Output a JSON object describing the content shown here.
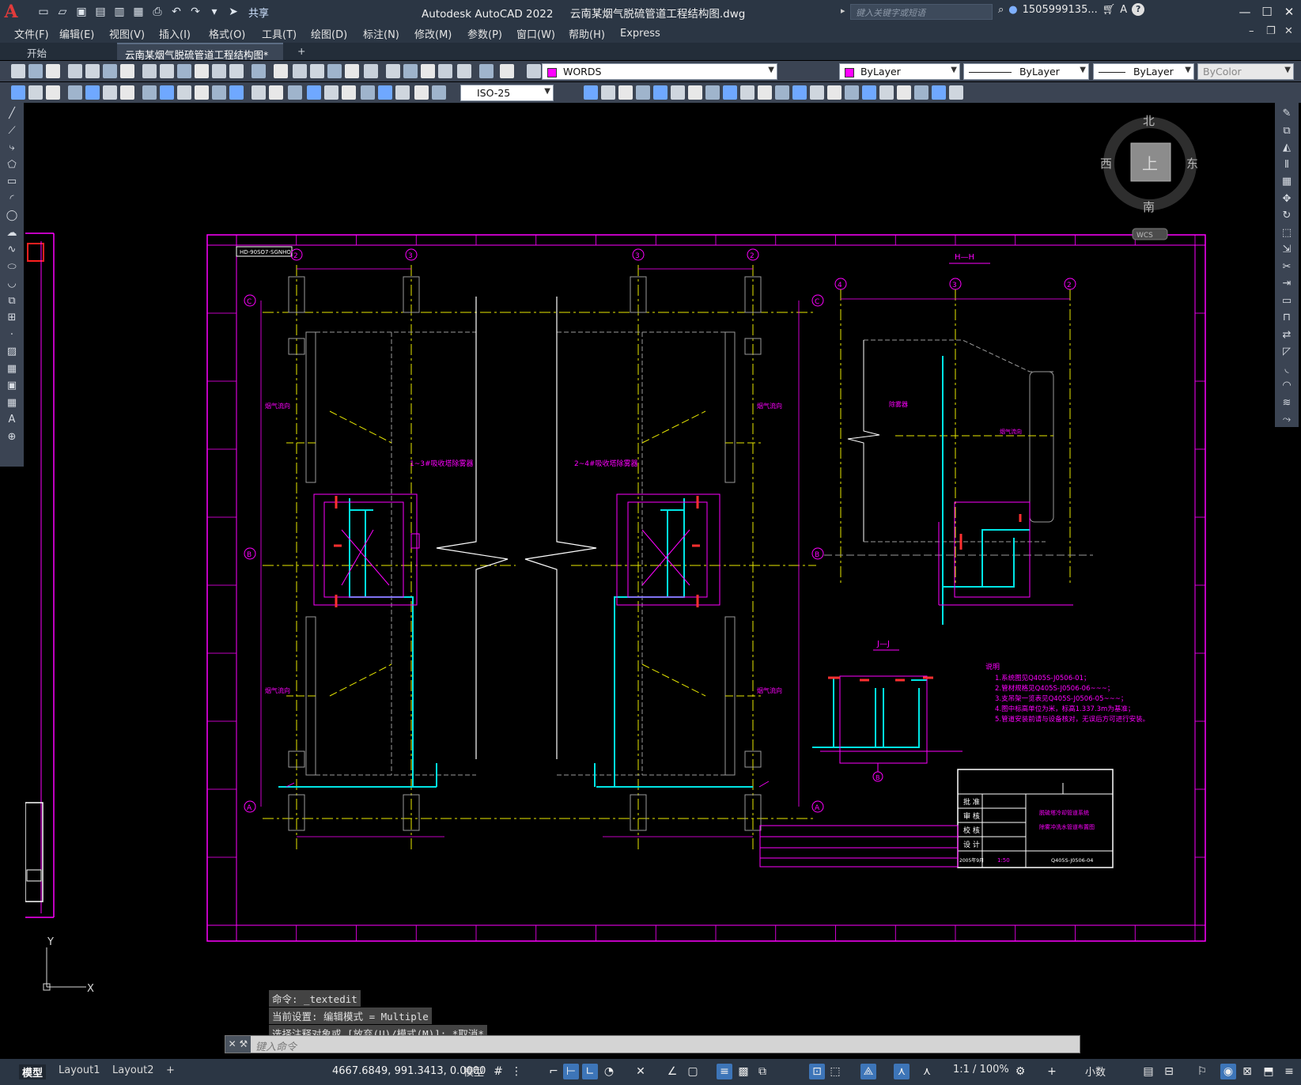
{
  "app": {
    "logo": "A",
    "title": "Autodesk AutoCAD 2022",
    "filename": "云南某烟气脱硫管道工程结构图.dwg",
    "share_label": "共享",
    "search_placeholder": "键入关键字或短语",
    "user": "1505999135...",
    "help": "?"
  },
  "menu": [
    "文件(F)",
    "编辑(E)",
    "视图(V)",
    "插入(I)",
    "格式(O)",
    "工具(T)",
    "绘图(D)",
    "标注(N)",
    "修改(M)",
    "参数(P)",
    "窗口(W)",
    "帮助(H)",
    "Express"
  ],
  "tabs": {
    "start": "开始",
    "active": "云南某烟气脱硫管道工程结构图*",
    "close": "×",
    "add": "+"
  },
  "toolbar": {
    "layer": "WORDS",
    "color": "ByLayer",
    "linetype": "ByLayer",
    "lineweight": "ByLayer",
    "plotstyle": "ByColor",
    "dimstyle": "ISO-25"
  },
  "viewcube": {
    "north": "北",
    "south": "南",
    "east": "东",
    "west": "西",
    "top": "上",
    "wcs": "WCS"
  },
  "drawing": {
    "ref_code": "HD-90SO7-SGNHO",
    "section_h": "H—H",
    "section_j": "J—J",
    "label_left_center": "1~3#吸收塔除雾器",
    "label_mid_center": "2~4#吸收塔除雾器",
    "flue_flow": "烟气流向",
    "demister": "除雾器",
    "notes_title": "说明",
    "notes": [
      "1.系统图见Q405S-J0506-01；",
      "2.管材规格见Q405S-J0506-06~~~；",
      "3.支吊架一览表见Q405S-J0506-05~~~；",
      "4.图中标高单位为米，标高1.337.3m为基准；",
      "5.管道安装前请与设备核对，无误后方可进行安装。"
    ],
    "title_block": {
      "rows": [
        "批 准",
        "审 核",
        "校 核",
        "设 计"
      ],
      "project": "脱硫塔冷却管道系统",
      "drawing_name": "除雾冲洗水管道布置图",
      "scale": "1:50",
      "drawing_no": "Q405S-J0506-04",
      "date": "2005年9月"
    }
  },
  "command": {
    "history": [
      "命令: _textedit",
      "当前设置: 编辑模式 = Multiple",
      "选择注释对象或 [放弃(U)/模式(M)]: *取消*"
    ],
    "placeholder": "键入命令"
  },
  "status": {
    "model_tab": "模型",
    "layout1": "Layout1",
    "layout2": "Layout2",
    "add": "+",
    "coords": "4667.6849, 991.3413, 0.0000",
    "space": "模型",
    "scale": "1:1 / 100%",
    "units": "小数"
  },
  "ucs": {
    "x": "X",
    "y": "Y"
  },
  "colors": {
    "magenta": "#ff00ff",
    "yellow": "#e8e800",
    "cyan": "#00e5e5",
    "white": "#ffffff",
    "red": "#ff3030",
    "gray": "#9a9a9a"
  }
}
